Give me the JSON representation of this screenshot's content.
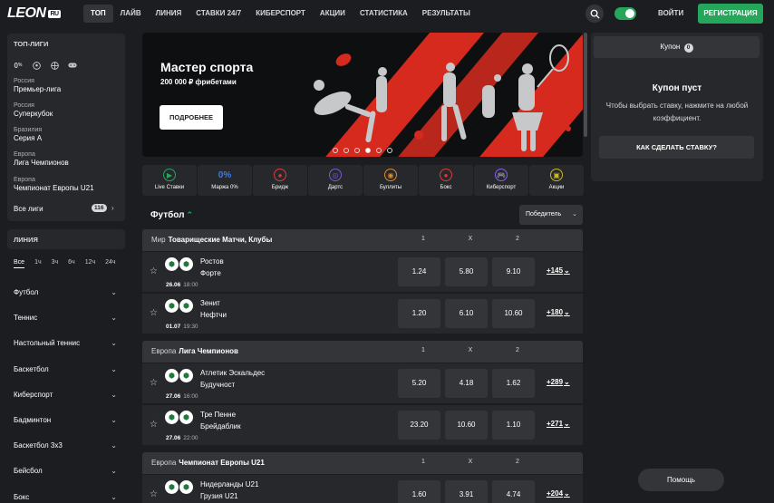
{
  "header": {
    "logo": "LEON",
    "logo_suffix": "RU",
    "nav": [
      "ТОП",
      "ЛАЙВ",
      "ЛИНИЯ",
      "СТАВКИ 24/7",
      "КИБЕРСПОРТ",
      "АКЦИИ",
      "СТАТИСТИКА",
      "РЕЗУЛЬТАТЫ"
    ],
    "login": "ВОЙТИ",
    "register": "РЕГИСТРАЦИЯ",
    "search_icon": "search-icon"
  },
  "sidebar": {
    "top_title": "ТОП-ЛИГИ",
    "top_icons": [
      "0%",
      "soccer-ball-icon",
      "basketball-icon",
      "gamepad-icon"
    ],
    "leagues": [
      {
        "region": "Россия",
        "name": "Премьер-лига"
      },
      {
        "region": "Россия",
        "name": "Суперкубок"
      },
      {
        "region": "Бразилия",
        "name": "Серия А"
      },
      {
        "region": "Европа",
        "name": "Лига Чемпионов"
      },
      {
        "region": "Европа",
        "name": "Чемпионат Европы U21"
      }
    ],
    "all_leagues": "Все лиги",
    "all_leagues_count": "116",
    "line_title": "ЛИНИЯ",
    "time_filters": [
      "Все",
      "1ч",
      "3ч",
      "6ч",
      "12ч",
      "24ч"
    ],
    "sports": [
      "Футбол",
      "Теннис",
      "Настольный теннис",
      "Баскетбол",
      "Киберспорт",
      "Бадминтон",
      "Баскетбол 3х3",
      "Бейсбол",
      "Бокс"
    ]
  },
  "banner": {
    "title": "Мастер спорта",
    "subtitle": "200 000 ₽ фрибетами",
    "button": "ПОДРОБНЕЕ",
    "slides": 6,
    "active_slide": 4
  },
  "categories": [
    {
      "label": "Live Ставки",
      "icon": "play-icon",
      "color": "#26a65b",
      "glyph": "▶"
    },
    {
      "label": "Маржа 0%",
      "icon": "zero-percent-icon",
      "color": "#3d7be8",
      "glyph": "0%"
    },
    {
      "label": "Бридж",
      "icon": "cards-icon",
      "color": "#e03b3b",
      "glyph": "♠"
    },
    {
      "label": "Дартс",
      "icon": "darts-icon",
      "color": "#7a5ad6",
      "glyph": "◎"
    },
    {
      "label": "Буллиты",
      "icon": "hockey-puck-icon",
      "color": "#e08a2b",
      "glyph": "◉"
    },
    {
      "label": "Бокс",
      "icon": "boxing-glove-icon",
      "color": "#e03b3b",
      "glyph": "●"
    },
    {
      "label": "Киберспорт",
      "icon": "gamepad-icon",
      "color": "#8b5cf6",
      "glyph": "🎮"
    },
    {
      "label": "Акции",
      "icon": "ticket-icon",
      "color": "#c8b826",
      "glyph": "▣"
    }
  ],
  "section": {
    "title": "Футбол",
    "market": "Победитель"
  },
  "groups": [
    {
      "region": "Мир",
      "league": "Товарищеские Матчи, Клубы",
      "cols": [
        "1",
        "X",
        "2"
      ],
      "matches": [
        {
          "team1": "Ростов",
          "team2": "Форте",
          "date": "26.06",
          "time": "18:00",
          "odds": [
            "1.24",
            "5.80",
            "9.10"
          ],
          "more": "+145"
        },
        {
          "team1": "Зенит",
          "team2": "Нефтчи",
          "date": "01.07",
          "time": "19:30",
          "odds": [
            "1.20",
            "6.10",
            "10.60"
          ],
          "more": "+180"
        }
      ]
    },
    {
      "region": "Европа",
      "league": "Лига Чемпионов",
      "cols": [
        "1",
        "X",
        "2"
      ],
      "matches": [
        {
          "team1": "Атлетик Эскальдес",
          "team2": "Будучност",
          "date": "27.06",
          "time": "16:00",
          "odds": [
            "5.20",
            "4.18",
            "1.62"
          ],
          "more": "+289"
        },
        {
          "team1": "Тре Пенне",
          "team2": "Брейдаблик",
          "date": "27.06",
          "time": "22:00",
          "odds": [
            "23.20",
            "10.60",
            "1.10"
          ],
          "more": "+271"
        }
      ]
    },
    {
      "region": "Европа",
      "league": "Чемпионат Европы U21",
      "cols": [
        "1",
        "X",
        "2"
      ],
      "matches": [
        {
          "team1": "Нидерланды U21",
          "team2": "Грузия U21",
          "date": "",
          "time": "",
          "odds": [
            "1.60",
            "3.91",
            "4.74"
          ],
          "more": "+204"
        }
      ]
    }
  ],
  "coupon": {
    "tab": "Купон",
    "count": "0",
    "empty_title": "Купон пуст",
    "empty_desc": "Чтобы выбрать ставку, нажмите на любой коэффициент.",
    "how_button": "КАК СДЕЛАТЬ СТАВКУ?"
  },
  "help": "Помощь",
  "colors": {
    "accent": "#26a65b",
    "bg": "#1c1d20",
    "panel": "#26282b",
    "button": "#333538",
    "brand_red": "#d62a1e"
  }
}
